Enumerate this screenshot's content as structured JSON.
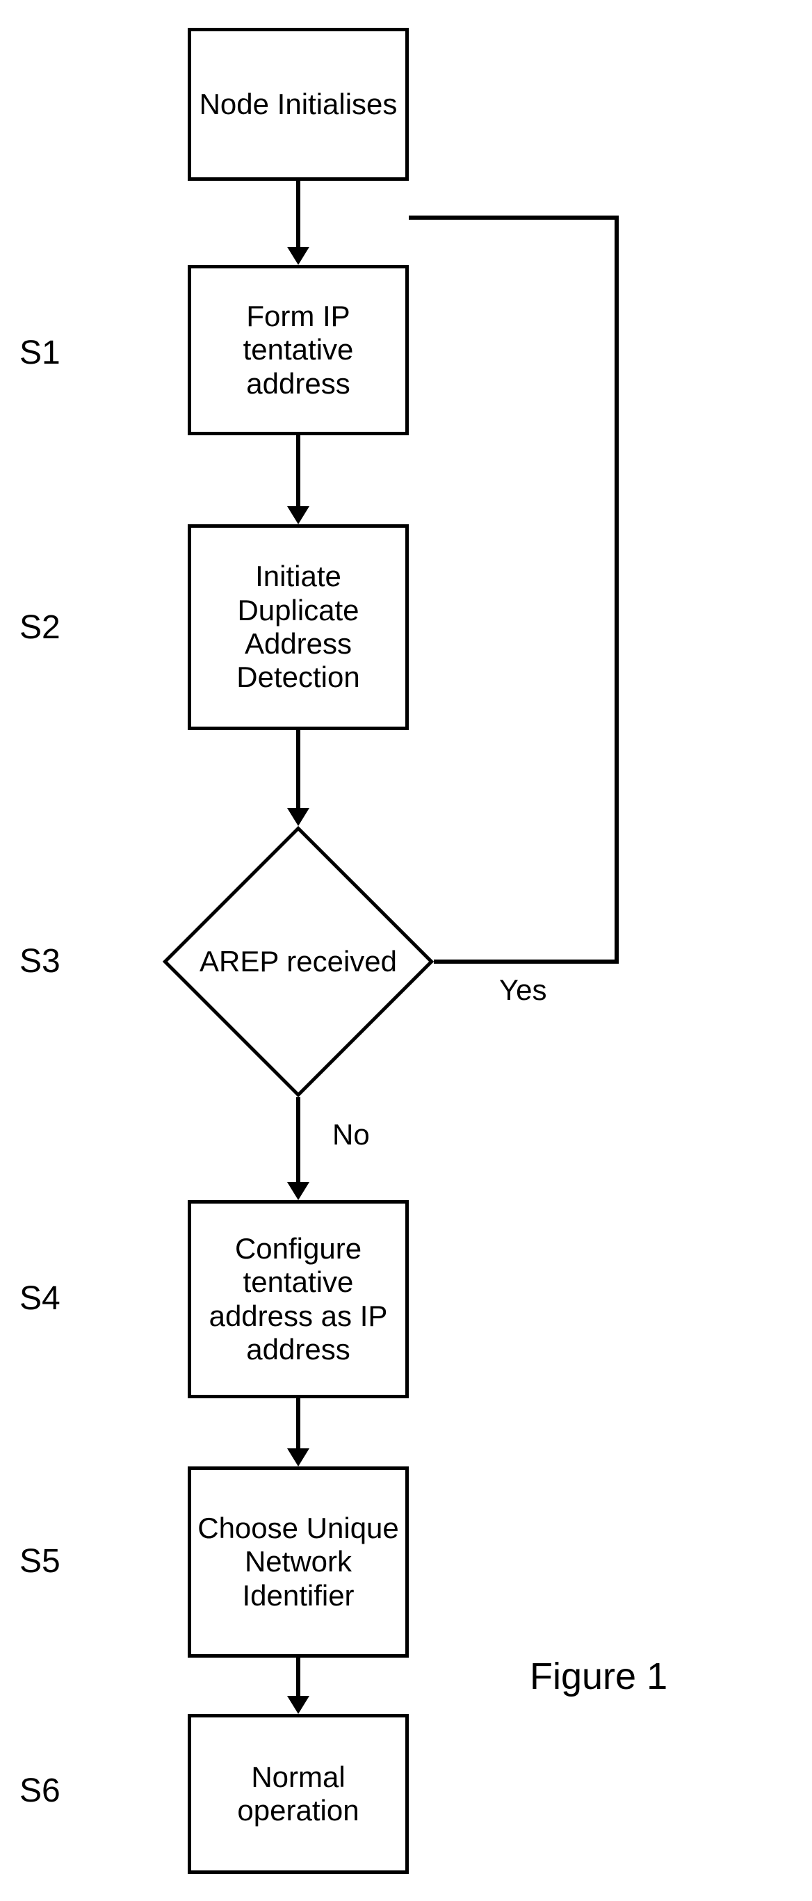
{
  "figure_title": "Figure 1",
  "steps": {
    "s0": {
      "label": "",
      "text": "Node Initialises"
    },
    "s1": {
      "label": "S1",
      "text": "Form IP tentative address"
    },
    "s2": {
      "label": "S2",
      "text": "Initiate Duplicate Address Detection"
    },
    "s3": {
      "label": "S3",
      "text": "AREP received"
    },
    "s4": {
      "label": "S4",
      "text": "Configure tentative address as IP address"
    },
    "s5": {
      "label": "S5",
      "text": "Choose Unique Network Identifier"
    },
    "s6": {
      "label": "S6",
      "text": "Normal operation"
    }
  },
  "edge_labels": {
    "yes": "Yes",
    "no": "No"
  }
}
